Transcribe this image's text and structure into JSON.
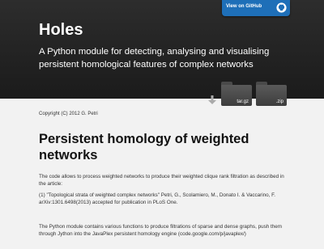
{
  "github_button": {
    "label": "View on GitHub",
    "icon": "github-octocat-icon"
  },
  "header": {
    "title": "Holes",
    "subtitle": "A Python module for detecting, analysing and visualising persistent homological features of complex networks"
  },
  "downloads": [
    {
      "label": "tar.gz",
      "icon": "folder-icon"
    },
    {
      "label": ".zip",
      "icon": "folder-icon"
    }
  ],
  "content": {
    "copyright": "Copyright (C) 2012 G. Petri",
    "heading": "Persistent homology of weighted networks",
    "paragraphs": [
      "The code allows to process weighted networks to produce their weighted clique rank filtration as described in the article:",
      "(1) \"Topological strata of weighted complex networks\" Petri, G., Scolamiero, M., Donato I. & Vaccarino, F. arXiv:1301.6498(2013) accepted for publication in PLoS One.",
      "The Python module contains various functions to produce filtrations of sparse and dense graphs, push them through Jython into the JavaPlex persistent homology engine (code.google.com/p/javaplex/)"
    ]
  }
}
